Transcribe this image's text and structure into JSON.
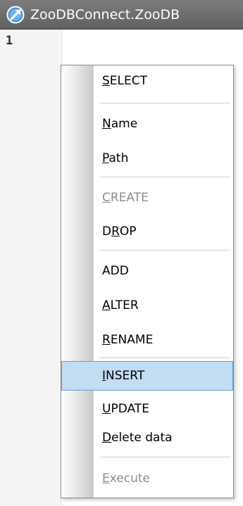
{
  "window": {
    "title": "ZooDBConnect.ZooDB",
    "icon": "database-connection-icon"
  },
  "editor": {
    "line_numbers": [
      "1"
    ]
  },
  "context_menu": {
    "items": [
      {
        "label": "SELECT",
        "key_prefix": "",
        "key": "S",
        "key_suffix": "ELECT",
        "enabled": true
      },
      {
        "label": "Name",
        "key_prefix": "",
        "key": "N",
        "key_suffix": "ame",
        "enabled": true
      },
      {
        "label": "Path",
        "key_prefix": "",
        "key": "P",
        "key_suffix": "ath",
        "enabled": true
      },
      {
        "label": "CREATE",
        "key_prefix": "",
        "key": "C",
        "key_suffix": "REATE",
        "enabled": false
      },
      {
        "label": "DROP",
        "key_prefix": "D",
        "key": "R",
        "key_suffix": "OP",
        "enabled": true
      },
      {
        "label": "ADD",
        "key_prefix": "ADD",
        "key": "",
        "key_suffix": "",
        "enabled": true
      },
      {
        "label": "ALTER",
        "key_prefix": "",
        "key": "A",
        "key_suffix": "LTER",
        "enabled": true
      },
      {
        "label": "RENAME",
        "key_prefix": "",
        "key": "R",
        "key_suffix": "ENAME",
        "enabled": true
      },
      {
        "label": "INSERT",
        "key_prefix": "",
        "key": "I",
        "key_suffix": "NSERT",
        "enabled": true,
        "highlighted": true
      },
      {
        "label": "UPDATE",
        "key_prefix": "",
        "key": "U",
        "key_suffix": "PDATE",
        "enabled": true
      },
      {
        "label": "Delete data",
        "key_prefix": "",
        "key": "D",
        "key_suffix": "elete data",
        "enabled": true
      },
      {
        "label": "Execute",
        "key_prefix": "",
        "key": "E",
        "key_suffix": "xecute",
        "enabled": false
      }
    ]
  }
}
